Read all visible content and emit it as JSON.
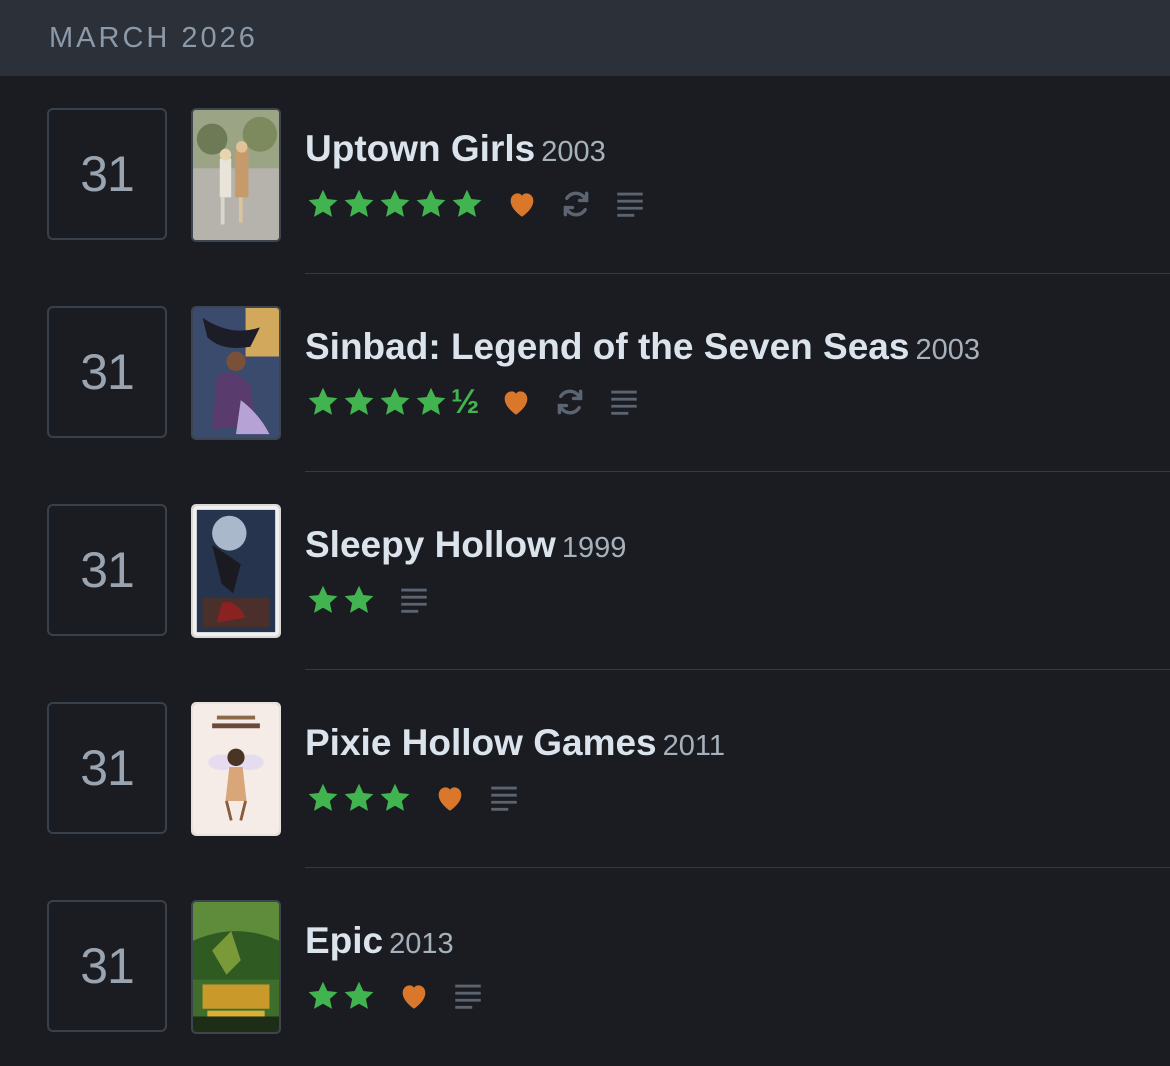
{
  "month_header": "MARCH 2026",
  "colors": {
    "star": "#41b34f",
    "heart": "#d9782a",
    "muted_icon": "#5b6470"
  },
  "entries": [
    {
      "day": "31",
      "title": "Uptown Girls",
      "year": "2003",
      "rating": 5,
      "half": "",
      "liked": true,
      "rewatch": true,
      "review": true,
      "poster": "uptown-girls-poster"
    },
    {
      "day": "31",
      "title": "Sinbad: Legend of the Seven Seas",
      "year": "2003",
      "rating": 4.5,
      "half": "½",
      "liked": true,
      "rewatch": true,
      "review": true,
      "poster": "sinbad-poster"
    },
    {
      "day": "31",
      "title": "Sleepy Hollow",
      "year": "1999",
      "rating": 2,
      "half": "",
      "liked": false,
      "rewatch": false,
      "review": true,
      "poster": "sleepy-hollow-poster"
    },
    {
      "day": "31",
      "title": "Pixie Hollow Games",
      "year": "2011",
      "rating": 3,
      "half": "",
      "liked": true,
      "rewatch": false,
      "review": true,
      "poster": "pixie-hollow-games-poster"
    },
    {
      "day": "31",
      "title": "Epic",
      "year": "2013",
      "rating": 2,
      "half": "",
      "liked": true,
      "rewatch": false,
      "review": true,
      "poster": "epic-poster"
    }
  ]
}
